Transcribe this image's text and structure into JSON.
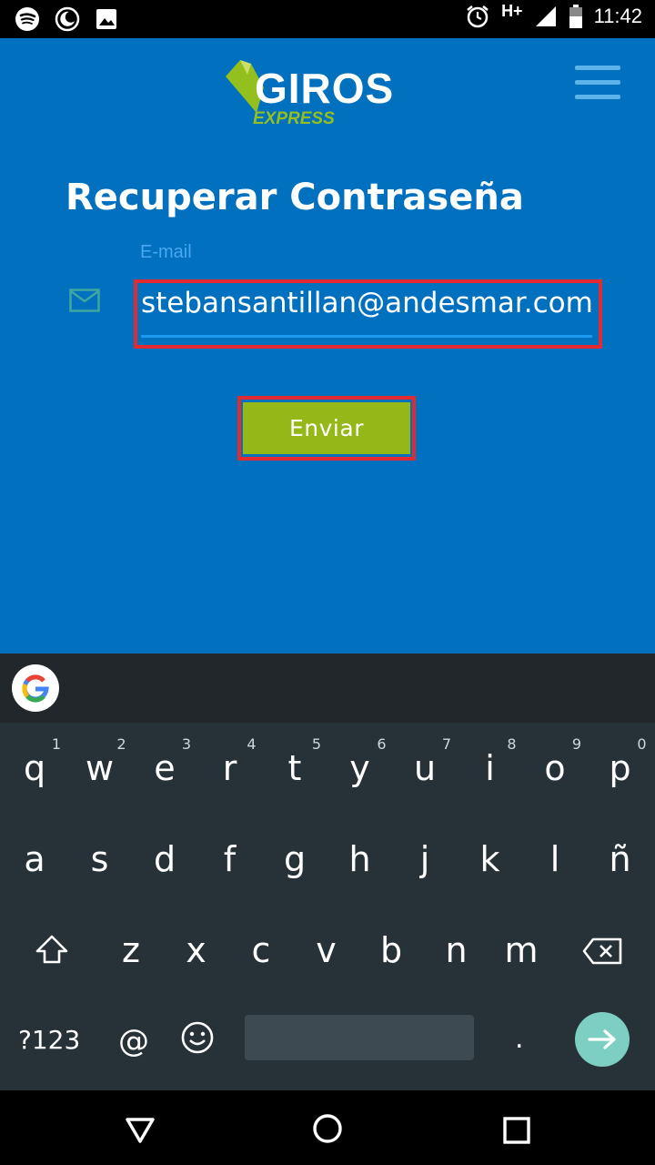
{
  "status_bar": {
    "time": "11:42",
    "network": "H+"
  },
  "header": {
    "brand": "GIROS",
    "brand_sub": "EXPRESS"
  },
  "page": {
    "title": "Recuperar Contraseña"
  },
  "form": {
    "email_label": "E-mail",
    "email_value": "stebansantillan@andesmar.com",
    "submit_label": "Enviar"
  },
  "keyboard": {
    "row1": [
      {
        "key": "q",
        "num": "1"
      },
      {
        "key": "w",
        "num": "2"
      },
      {
        "key": "e",
        "num": "3"
      },
      {
        "key": "r",
        "num": "4"
      },
      {
        "key": "t",
        "num": "5"
      },
      {
        "key": "y",
        "num": "6"
      },
      {
        "key": "u",
        "num": "7"
      },
      {
        "key": "i",
        "num": "8"
      },
      {
        "key": "o",
        "num": "9"
      },
      {
        "key": "p",
        "num": "0"
      }
    ],
    "row2": [
      "a",
      "s",
      "d",
      "f",
      "g",
      "h",
      "j",
      "k",
      "l",
      "ñ"
    ],
    "row3": [
      "z",
      "x",
      "c",
      "v",
      "b",
      "n",
      "m"
    ],
    "symbols_label": "?123",
    "at_label": "@",
    "dot_label": "."
  },
  "colors": {
    "app_bg": "#0070bf",
    "accent_green": "#93b818",
    "highlight_red": "#e22a31"
  }
}
